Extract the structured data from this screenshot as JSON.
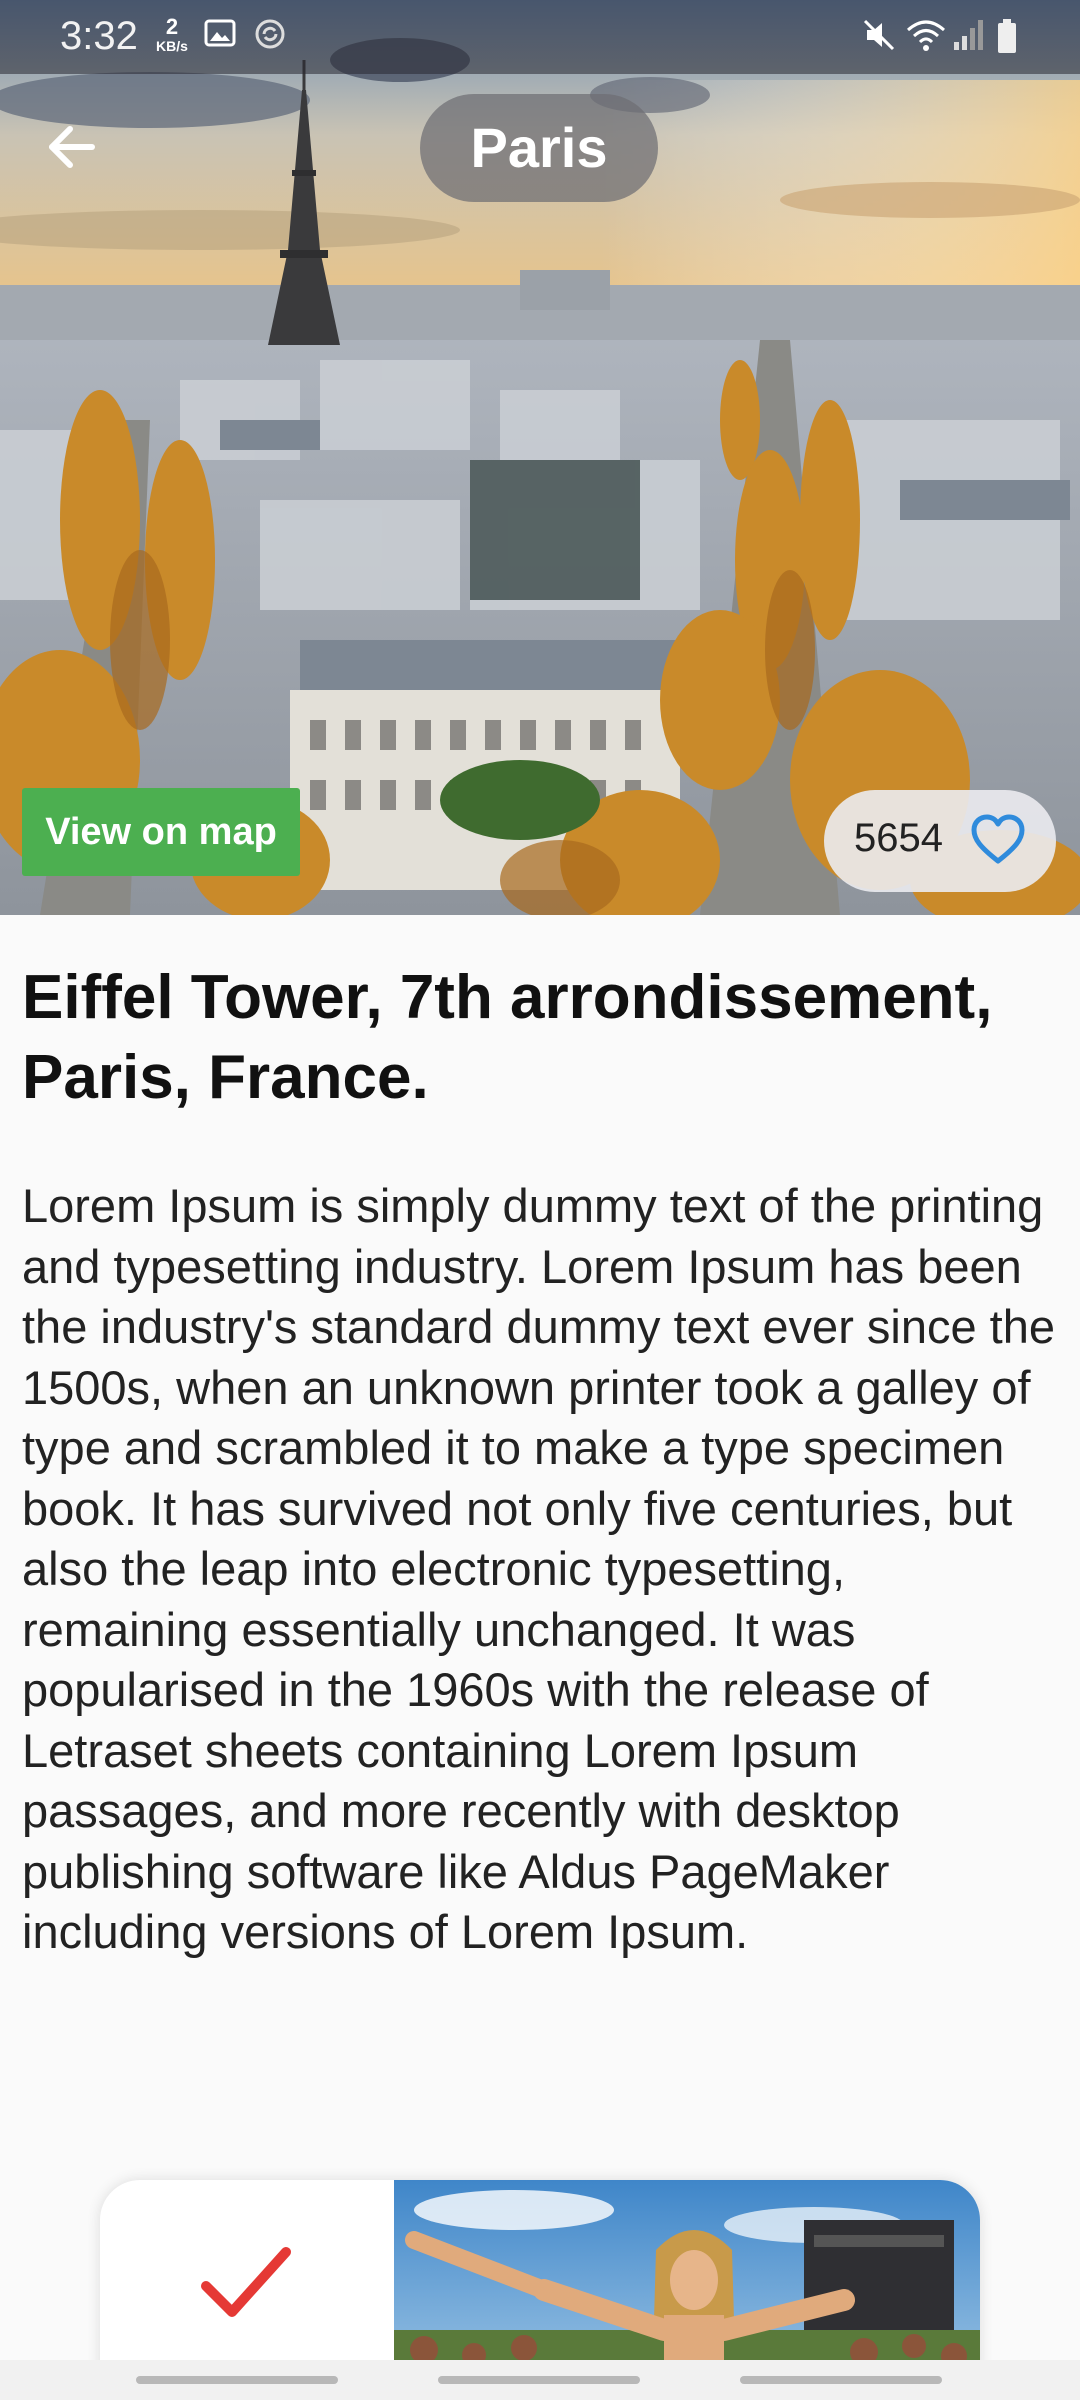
{
  "status_bar": {
    "time": "3:32",
    "net_speed_value": "2",
    "net_speed_unit": "KB/s",
    "icons": [
      "image-icon",
      "sync-icon",
      "mute-icon",
      "wifi-icon",
      "signal-icon",
      "battery-icon"
    ]
  },
  "header": {
    "title": "Paris",
    "back_icon": "arrow-left-icon"
  },
  "hero": {
    "map_button_label": "View on map",
    "likes_count": "5654",
    "heart_icon": "heart-outline-icon",
    "accent_color": "#4caf50",
    "heart_color": "#2f8bdc"
  },
  "place": {
    "title": "Eiffel Tower, 7th arrondissement, Paris, France.",
    "description": "Lorem Ipsum is simply dummy text of the printing and typesetting industry. Lorem Ipsum has been the industry's standard dummy text ever since the 1500s, when an unknown printer took a galley of type and scrambled it to make a type specimen book. It has survived not only five centuries, but also the leap into electronic typesetting, remaining essentially unchanged. It was popularised in the 1960s with the release of Letraset sheets containing Lorem Ipsum passages, and more recently with desktop publishing software like Aldus PageMaker including versions of Lorem Ipsum."
  },
  "bottom_card": {
    "check_icon": "checkmark-icon",
    "check_color": "#e53935"
  }
}
